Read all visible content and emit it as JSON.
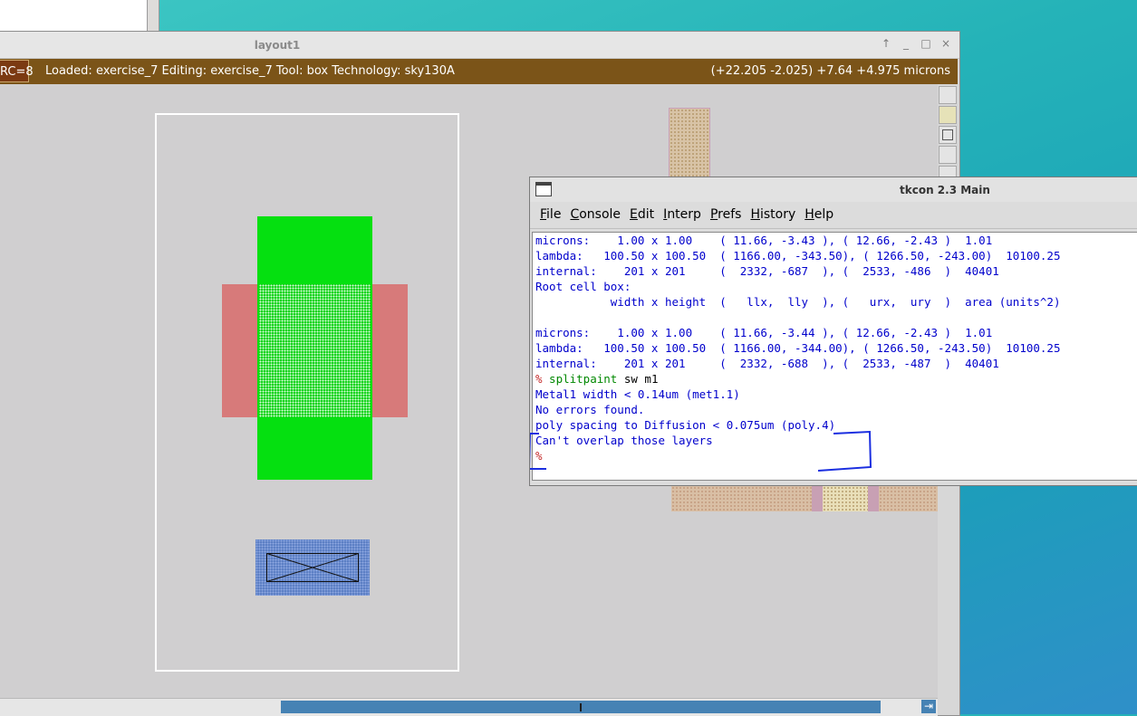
{
  "layout_window": {
    "title": "layout1",
    "window_buttons": [
      "↑",
      "_",
      "□",
      "×"
    ],
    "status_badge": "RC=8",
    "status_message": "Loaded: exercise_7 Editing: exercise_7 Tool: box  Technology: sky130A",
    "coordinates": "(+22.205 -2.025) +7.64 +4.975 microns",
    "scroll_arrow": "⇥"
  },
  "tkcon": {
    "title": "tkcon 2.3 Main",
    "menu": [
      "File",
      "Console",
      "Edit",
      "Interp",
      "Prefs",
      "History",
      "Help"
    ],
    "lines": [
      "microns:    1.00 x 1.00    ( 11.66, -3.43 ), ( 12.66, -2.43 )  1.01",
      "lambda:   100.50 x 100.50  ( 1166.00, -343.50), ( 1266.50, -243.00)  10100.25",
      "internal:    201 x 201     (  2332, -687  ), (  2533, -486  )  40401",
      "Root cell box:",
      "           width x height  (   llx,  lly  ), (   urx,  ury  )  area (units^2)",
      "",
      "microns:    1.00 x 1.00    ( 11.66, -3.44 ), ( 12.66, -2.43 )  1.01",
      "lambda:   100.50 x 100.50  ( 1166.00, -344.00), ( 1266.50, -243.50)  10100.25",
      "internal:    201 x 201     (  2332, -688  ), (  2533, -487  )  40401"
    ],
    "prompt_symbol": "%",
    "command": " splitpaint",
    "command_args": " sw m1",
    "drc_line_1": "Metal1 width < 0.14um (met1.1)",
    "drc_line_2": "No errors found.",
    "drc_line_3": "poly spacing to Diffusion < 0.075um (poly.4)",
    "drc_line_4": "Can't overlap those layers",
    "final_prompt": "%"
  },
  "colors": {
    "status_bar": "#7b5418",
    "poly": "#05e010",
    "diffusion": "#d77a7a",
    "metal": "#5b7fc4",
    "console_text": "#0000cc",
    "annotation_ink": "#1a2ee0"
  }
}
